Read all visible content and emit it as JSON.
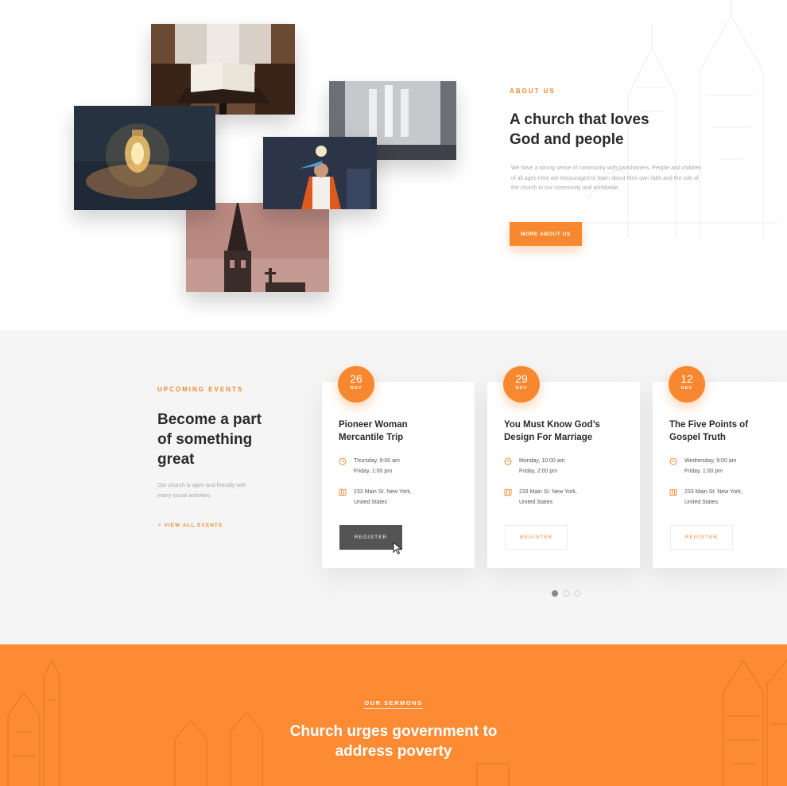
{
  "about": {
    "eyebrow": "ABOUT US",
    "title_line1": "A church that loves",
    "title_line2": "God and people",
    "text": "We have a strong sense of community with parishioners. People and children of all ages here are encouraged to learn about their own faith and the role of the church in our community and worldwide.",
    "button_label": "MORE ABOUT US"
  },
  "events": {
    "eyebrow": "UPCOMING EVENTS",
    "title_line1": "Become a part",
    "title_line2": "of something",
    "title_line3": "great",
    "text": "Our church is open and friendly with many social activities.",
    "view_all_label": "+ VIEW ALL EVENTS",
    "cards": [
      {
        "day": "26",
        "month": "NOV",
        "title_line1": "Pioneer Woman",
        "title_line2": "Mercantile Trip",
        "time_line1": "Thursday, 9:00 am",
        "time_line2": "Friday, 1:00 pm",
        "loc_line1": "233 Main St. New York,",
        "loc_line2": "United States",
        "register_label": "REGISTER"
      },
      {
        "day": "29",
        "month": "NOV",
        "title_line1": "You Must Know God’s",
        "title_line2": "Design For Marriage",
        "time_line1": "Monday, 10:00 am",
        "time_line2": "Friday, 2:00 pm",
        "loc_line1": "233 Main St. New York,",
        "loc_line2": "United States",
        "register_label": "REGISTER"
      },
      {
        "day": "12",
        "month": "DEC",
        "title_line1": "The Five Points of",
        "title_line2": "Gospel Truth",
        "time_line1": "Wednesday, 9:00 am",
        "time_line2": "Friday, 1:00 pm",
        "loc_line1": "233 Main St. New York,",
        "loc_line2": "United States",
        "register_label": "REGISTER"
      }
    ],
    "carousel_active_index": 0,
    "carousel_page_count": 3
  },
  "sermons": {
    "eyebrow": "OUR SERMONS",
    "title_line1": "Church urges government to",
    "title_line2": "address poverty"
  },
  "colors": {
    "accent": "#f7882f",
    "sermons_bg": "#fd8b33",
    "events_bg": "#f5f5f5",
    "dark_button": "#545454"
  },
  "icons": {
    "time": "clock-icon",
    "location": "map-icon",
    "cursor": "mouse-pointer-icon"
  }
}
